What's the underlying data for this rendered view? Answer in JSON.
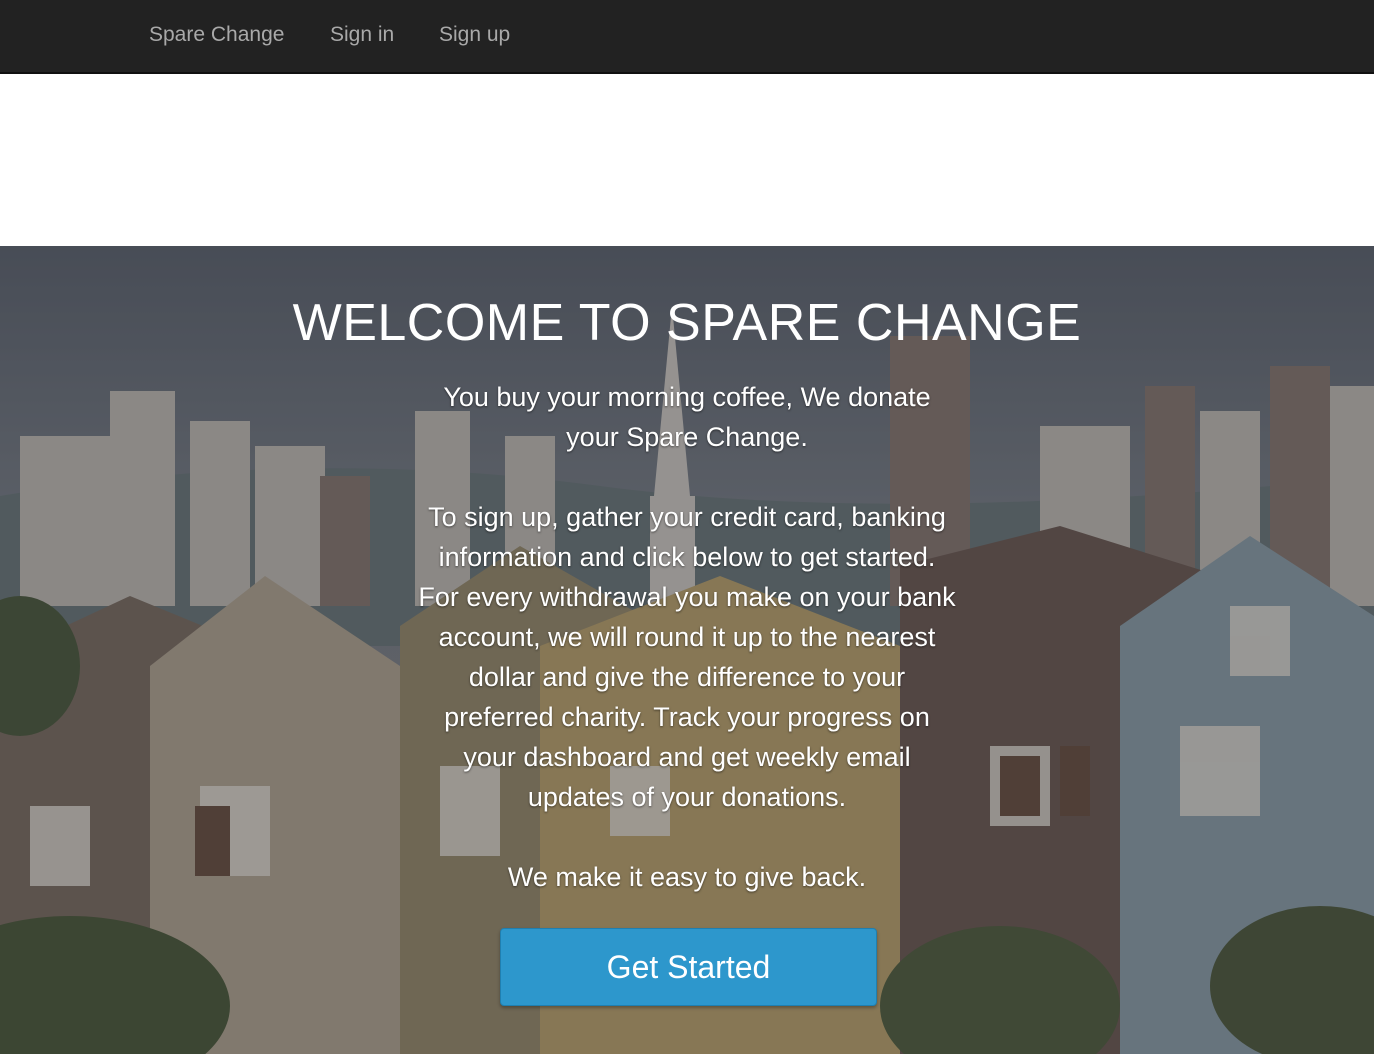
{
  "nav": {
    "brand": "Spare Change",
    "sign_in": "Sign in",
    "sign_up": "Sign up"
  },
  "hero": {
    "title": "WELCOME TO SPARE CHANGE",
    "tagline": "You buy your morning coffee, We donate your Spare Change.",
    "description": "To sign up, gather your credit card, banking information and click below to get started. For every withdrawal you make on your bank account, we will round it up to the nearest dollar and give the difference to your preferred charity. Track your progress on your dashboard and get weekly email updates of your donations.",
    "closing": "We make it easy to give back.",
    "cta_label": "Get Started",
    "background_image": "painted-ladies-city-skyline-photo"
  },
  "colors": {
    "navbar": "#222222",
    "nav_link": "#a9a9a9",
    "cta": "#2d97cc"
  }
}
